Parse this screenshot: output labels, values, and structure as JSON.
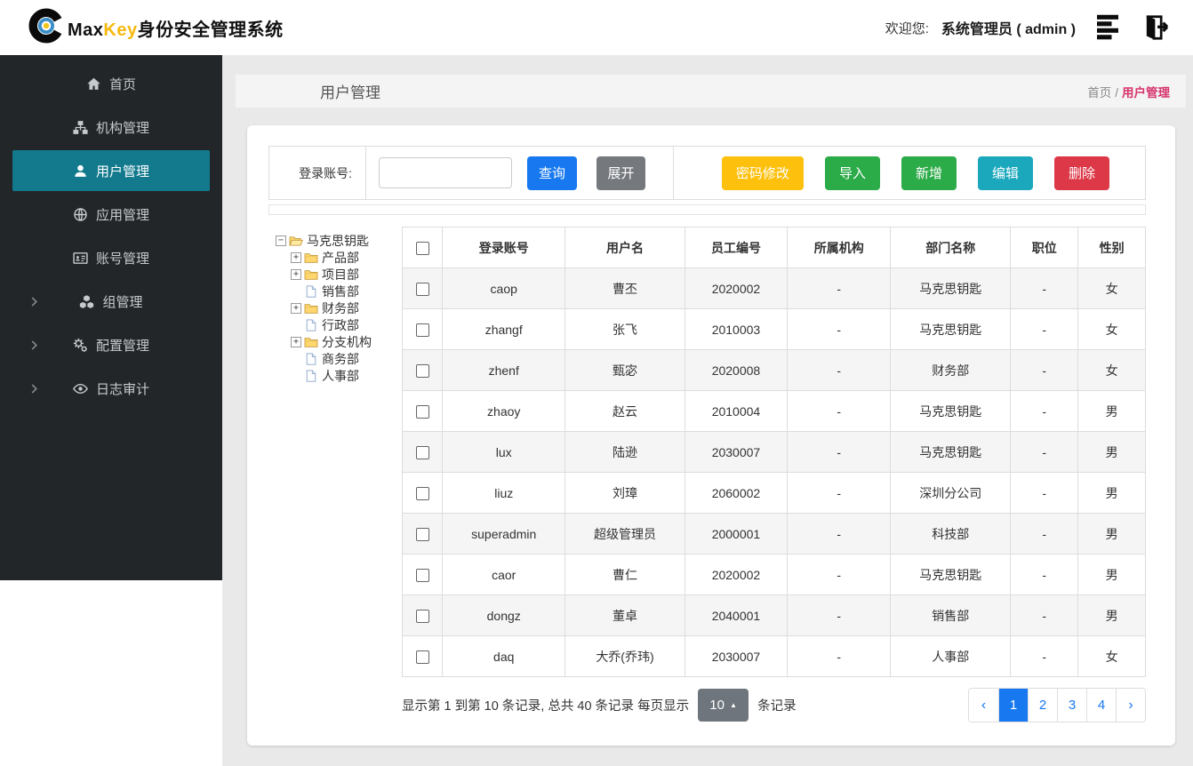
{
  "header": {
    "brand_max": "Max",
    "brand_key": "Key",
    "brand_suffix": "身份安全管理系统",
    "welcome_label": "欢迎您:",
    "username": "系统管理员 ( admin )"
  },
  "sidebar": {
    "items": [
      {
        "label": "首页",
        "icon": "home",
        "active": false,
        "chevron": false
      },
      {
        "label": "机构管理",
        "icon": "sitemap",
        "active": false,
        "chevron": false
      },
      {
        "label": "用户管理",
        "icon": "user",
        "active": true,
        "chevron": false
      },
      {
        "label": "应用管理",
        "icon": "globe",
        "active": false,
        "chevron": false
      },
      {
        "label": "账号管理",
        "icon": "id-card",
        "active": false,
        "chevron": false
      },
      {
        "label": "组管理",
        "icon": "cubes",
        "active": false,
        "chevron": true
      },
      {
        "label": "配置管理",
        "icon": "gears",
        "active": false,
        "chevron": true
      },
      {
        "label": "日志审计",
        "icon": "eye",
        "active": false,
        "chevron": true
      }
    ]
  },
  "page": {
    "title": "用户管理",
    "breadcrumb_home": "首页",
    "breadcrumb_sep": "/",
    "breadcrumb_current": "用户管理"
  },
  "filter": {
    "label": "登录账号:",
    "input_value": "",
    "search_label": "查询",
    "expand_label": "展开",
    "actions": [
      {
        "name": "password-modify",
        "label": "密码修改",
        "color": "#fdc00d"
      },
      {
        "name": "import",
        "label": "导入",
        "color": "#2cab49"
      },
      {
        "name": "add",
        "label": "新增",
        "color": "#2cab49"
      },
      {
        "name": "edit",
        "label": "编辑",
        "color": "#1ba8bc"
      },
      {
        "name": "delete",
        "label": "删除",
        "color": "#dc3848"
      }
    ]
  },
  "tree": {
    "nodes": [
      {
        "label": "马克思钥匙",
        "icon": "folder-open",
        "expander": "minus",
        "level": 0
      },
      {
        "label": "产品部",
        "icon": "folder",
        "expander": "plus",
        "level": 1
      },
      {
        "label": "项目部",
        "icon": "folder",
        "expander": "plus",
        "level": 1
      },
      {
        "label": "销售部",
        "icon": "file",
        "expander": "none",
        "level": 1
      },
      {
        "label": "财务部",
        "icon": "folder",
        "expander": "plus",
        "level": 1
      },
      {
        "label": "行政部",
        "icon": "file",
        "expander": "none",
        "level": 1
      },
      {
        "label": "分支机构",
        "icon": "folder",
        "expander": "plus",
        "level": 1
      },
      {
        "label": "商务部",
        "icon": "file",
        "expander": "none",
        "level": 1
      },
      {
        "label": "人事部",
        "icon": "file",
        "expander": "none",
        "level": 1
      }
    ]
  },
  "table": {
    "columns": [
      "登录账号",
      "用户名",
      "员工编号",
      "所属机构",
      "部门名称",
      "职位",
      "性别"
    ],
    "rows": [
      [
        "caop",
        "曹丕",
        "2020002",
        "-",
        "马克思钥匙",
        "-",
        "女"
      ],
      [
        "zhangf",
        "张飞",
        "2010003",
        "-",
        "马克思钥匙",
        "-",
        "女"
      ],
      [
        "zhenf",
        "甄宓",
        "2020008",
        "-",
        "财务部",
        "-",
        "女"
      ],
      [
        "zhaoy",
        "赵云",
        "2010004",
        "-",
        "马克思钥匙",
        "-",
        "男"
      ],
      [
        "lux",
        "陆逊",
        "2030007",
        "-",
        "马克思钥匙",
        "-",
        "男"
      ],
      [
        "liuz",
        "刘璋",
        "2060002",
        "-",
        "深圳分公司",
        "-",
        "男"
      ],
      [
        "superadmin",
        "超级管理员",
        "2000001",
        "-",
        "科技部",
        "-",
        "男"
      ],
      [
        "caor",
        "曹仁",
        "2020002",
        "-",
        "马克思钥匙",
        "-",
        "男"
      ],
      [
        "dongz",
        "董卓",
        "2040001",
        "-",
        "销售部",
        "-",
        "男"
      ],
      [
        "daq",
        "大乔(乔玮)",
        "2030007",
        "-",
        "人事部",
        "-",
        "女"
      ]
    ]
  },
  "pagination": {
    "summary_prefix": "显示第 1 到第 10 条记录, 总共 40 条记录 每页显示",
    "page_size": "10",
    "summary_suffix": "条记录",
    "prev": "‹",
    "next": "›",
    "pages": [
      "1",
      "2",
      "3",
      "4"
    ],
    "active_page": "1"
  },
  "colors": {
    "primary_blue": "#1778f0",
    "sidebar_active_teal": "#137a8e",
    "breadcrumb_active_pink": "#d6336c",
    "sidebar_bg": "#232629"
  }
}
